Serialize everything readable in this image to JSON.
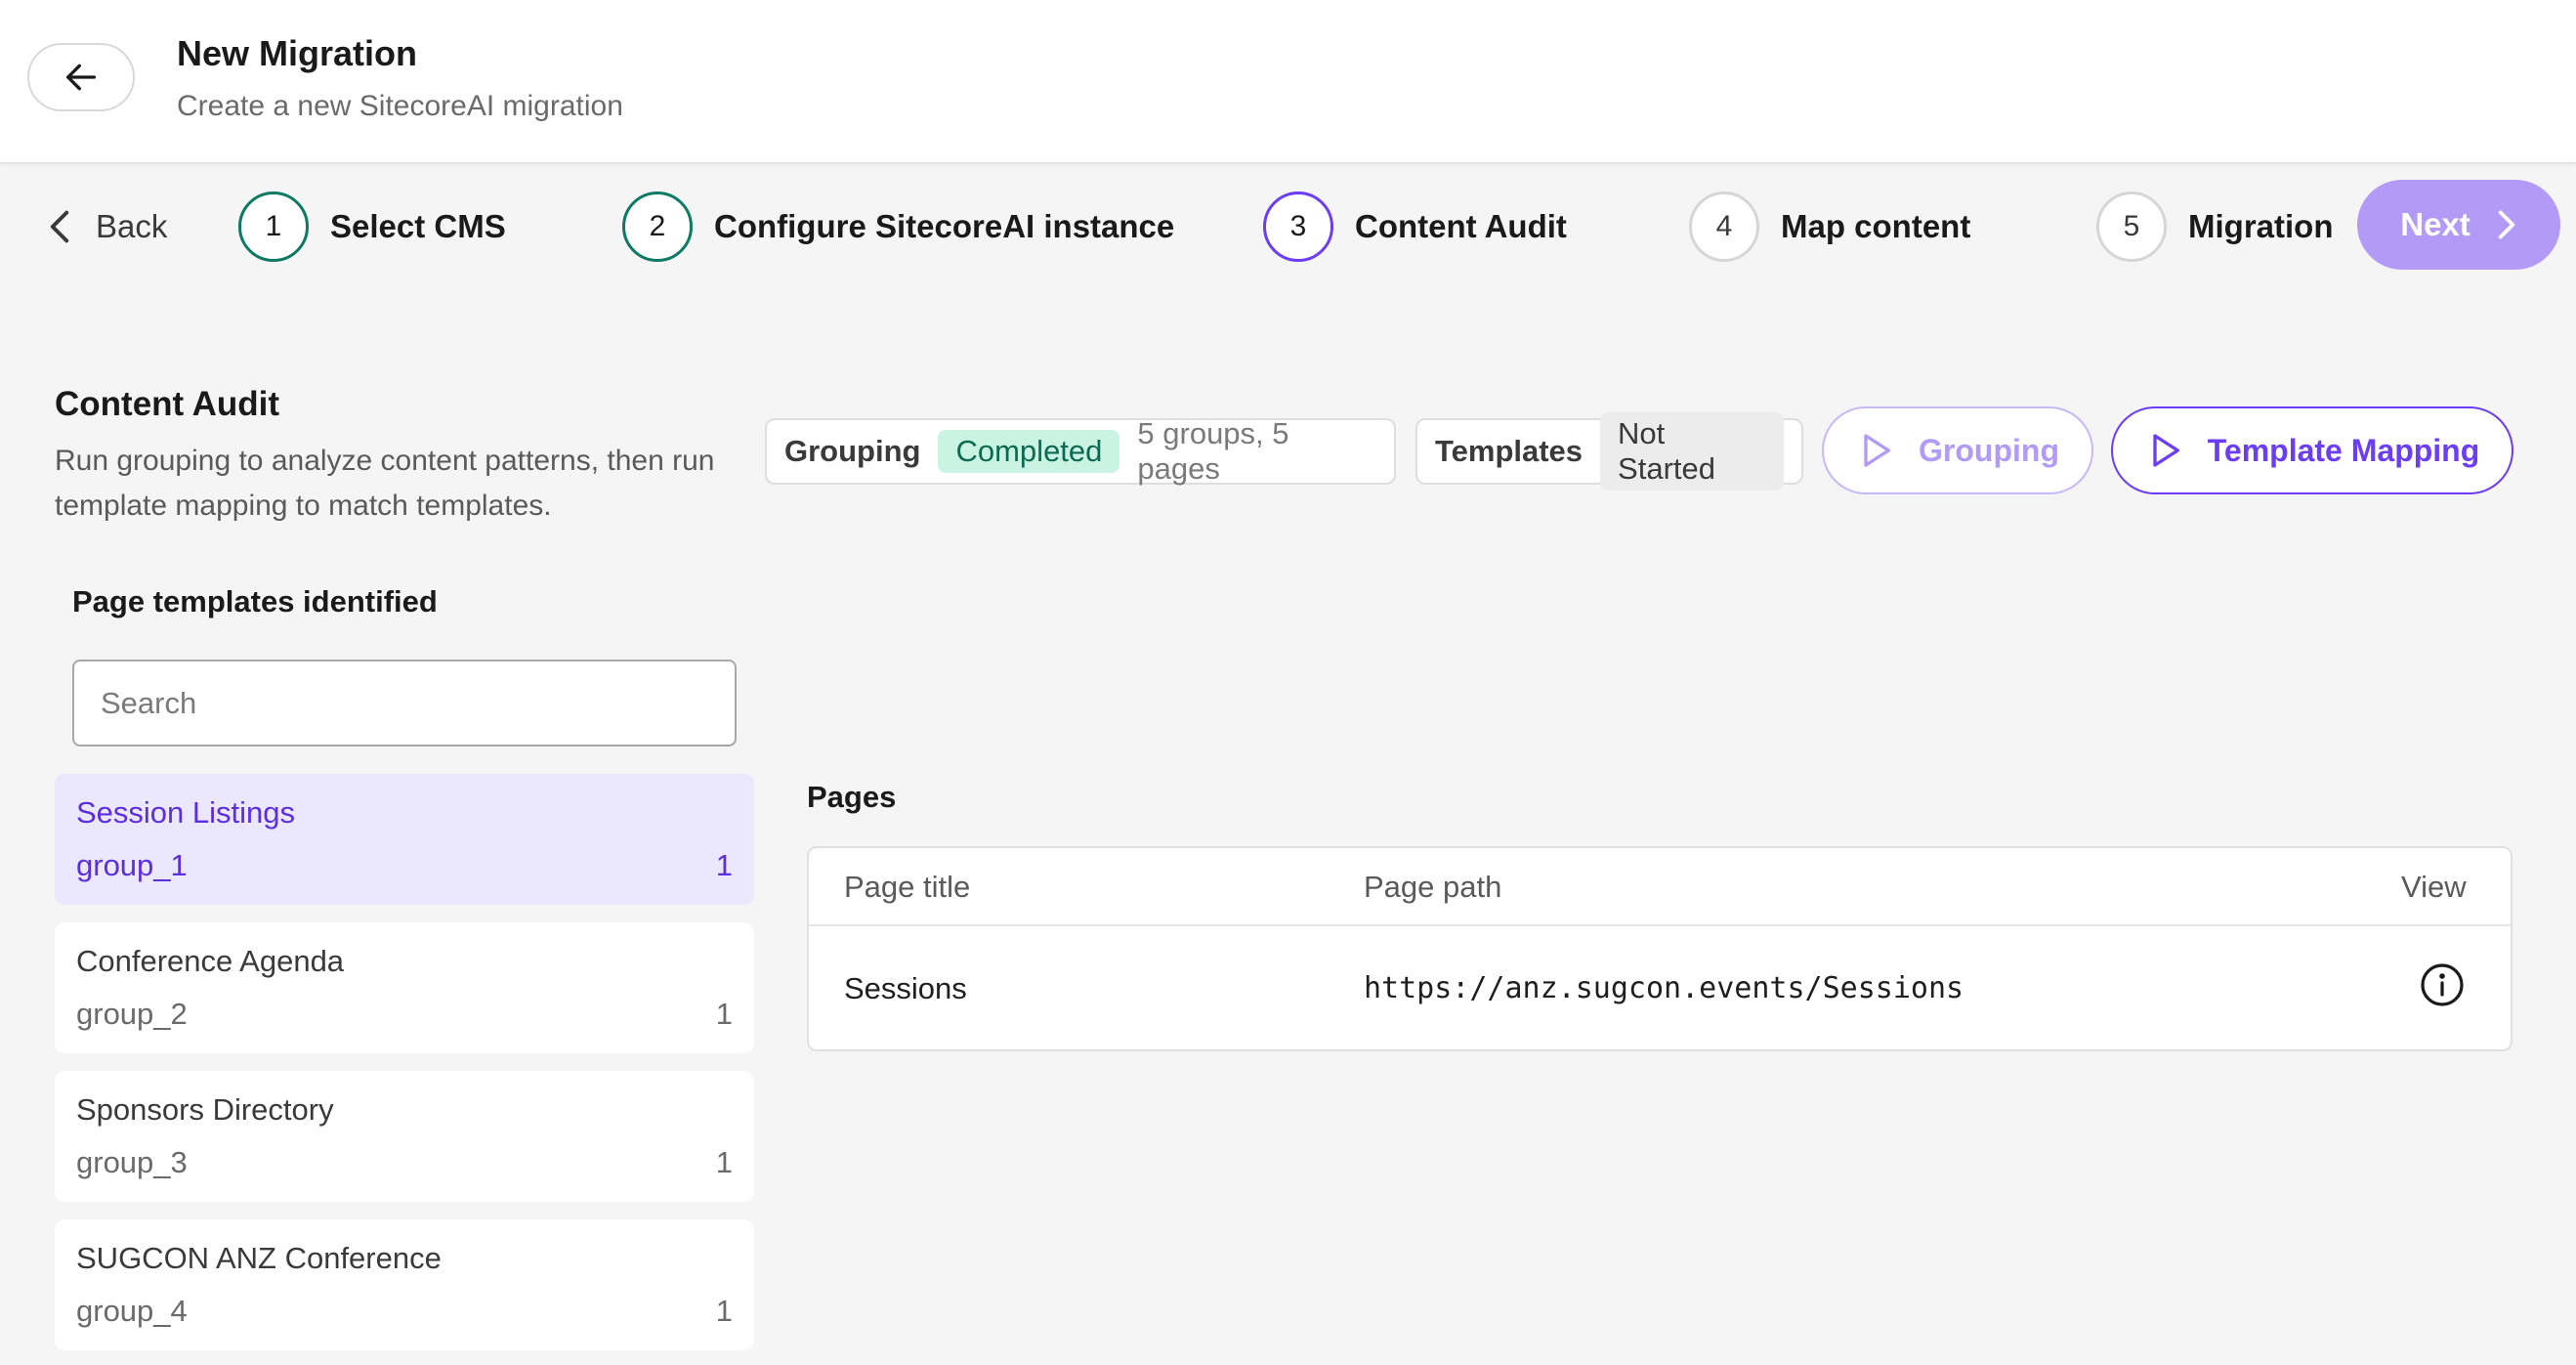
{
  "header": {
    "title": "New Migration",
    "subtitle": "Create a new SitecoreAI migration",
    "back_icon": "arrow-left-icon"
  },
  "stepper": {
    "back_label": "Back",
    "steps": [
      {
        "number": "1",
        "label": "Select CMS",
        "state": "done"
      },
      {
        "number": "2",
        "label": "Configure SitecoreAI instance",
        "state": "done"
      },
      {
        "number": "3",
        "label": "Content Audit",
        "state": "active"
      },
      {
        "number": "4",
        "label": "Map content",
        "state": "todo"
      },
      {
        "number": "5",
        "label": "Migration",
        "state": "todo"
      }
    ],
    "next_label": "Next"
  },
  "content_audit": {
    "title": "Content Audit",
    "description": "Run grouping to analyze content patterns, then run template mapping to match templates.",
    "grouping_status": {
      "label": "Grouping",
      "status": "Completed",
      "meta": "5 groups, 5 pages"
    },
    "templates_status": {
      "label": "Templates",
      "status": "Not Started"
    },
    "run_grouping_label": "Grouping",
    "run_template_mapping_label": "Template Mapping"
  },
  "templates_panel": {
    "title": "Page templates identified",
    "search_placeholder": "Search",
    "items": [
      {
        "name": "Session Listings",
        "group": "group_1",
        "count": "1",
        "selected": true
      },
      {
        "name": "Conference Agenda",
        "group": "group_2",
        "count": "1",
        "selected": false
      },
      {
        "name": "Sponsors Directory",
        "group": "group_3",
        "count": "1",
        "selected": false
      },
      {
        "name": "SUGCON ANZ Conference",
        "group": "group_4",
        "count": "1",
        "selected": false
      }
    ]
  },
  "pages_panel": {
    "title": "Pages",
    "columns": [
      "Page title",
      "Page path",
      "View"
    ],
    "rows": [
      {
        "title": "Sessions",
        "path": "https://anz.sugcon.events/Sessions",
        "view_icon": "info-icon"
      }
    ]
  },
  "colors": {
    "accent": "#6b3df5",
    "accent_light": "#b39af7",
    "done": "#0e7a63",
    "completed_bg": "#c9f3e3",
    "selected_bg": "#ebe7fc"
  }
}
